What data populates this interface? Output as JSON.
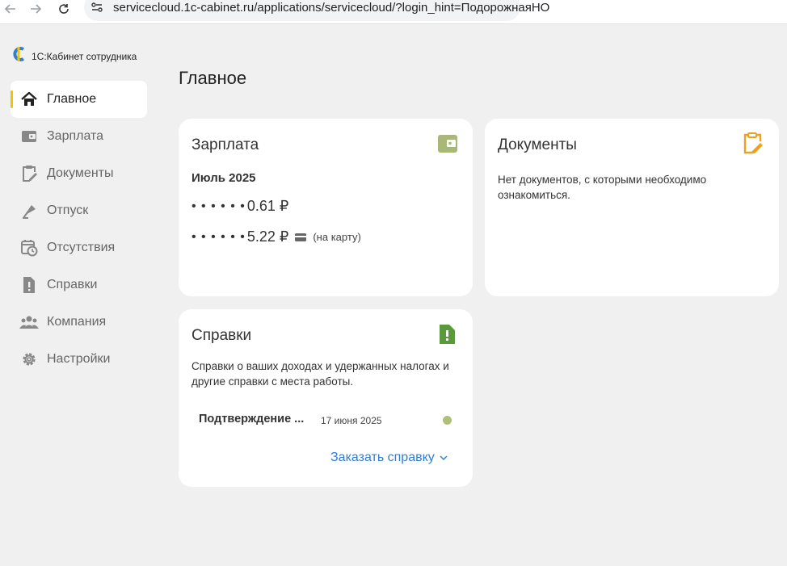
{
  "browser": {
    "url": "servicecloud.1c-cabinet.ru/applications/servicecloud/?login_hint=ПодорожнаяНО"
  },
  "app": {
    "title": "1С:Кабинет сотрудника"
  },
  "sidebar": {
    "items": [
      {
        "label": "Главное",
        "icon": "home-icon",
        "active": true
      },
      {
        "label": "Зарплата",
        "icon": "wallet-icon"
      },
      {
        "label": "Документы",
        "icon": "clipboard-edit-icon"
      },
      {
        "label": "Отпуск",
        "icon": "beach-icon"
      },
      {
        "label": "Отсутствия",
        "icon": "calendar-clock-icon"
      },
      {
        "label": "Справки",
        "icon": "document-alert-icon"
      },
      {
        "label": "Компания",
        "icon": "people-icon"
      },
      {
        "label": "Настройки",
        "icon": "gear-icon"
      }
    ]
  },
  "main": {
    "title": "Главное",
    "salary": {
      "title": "Зарплата",
      "period": "Июль 2025",
      "lines": [
        {
          "dots": "• • •  • • •",
          "amount": "0.61 ₽",
          "note": ""
        },
        {
          "dots": "• • •  • • •",
          "amount": "5.22 ₽",
          "note": "(на карту)"
        }
      ]
    },
    "documents": {
      "title": "Документы",
      "text": "Нет документов, с которыми необходимо ознакомиться."
    },
    "certificates": {
      "title": "Справки",
      "description": "Справки о ваших доходах и удержанных налогах и другие справки с места работы.",
      "item": {
        "title": "Подтверждение ...",
        "date": "17 июня 2025"
      },
      "order_label": "Заказать справку"
    }
  },
  "colors": {
    "accent_yellow": "#f5c400",
    "salary_icon": "#a8b878",
    "documents_icon": "#f0a020",
    "certificates_icon": "#5a9a3a",
    "link_blue": "#2f7fd6",
    "status_dot": "#b0c07a"
  }
}
